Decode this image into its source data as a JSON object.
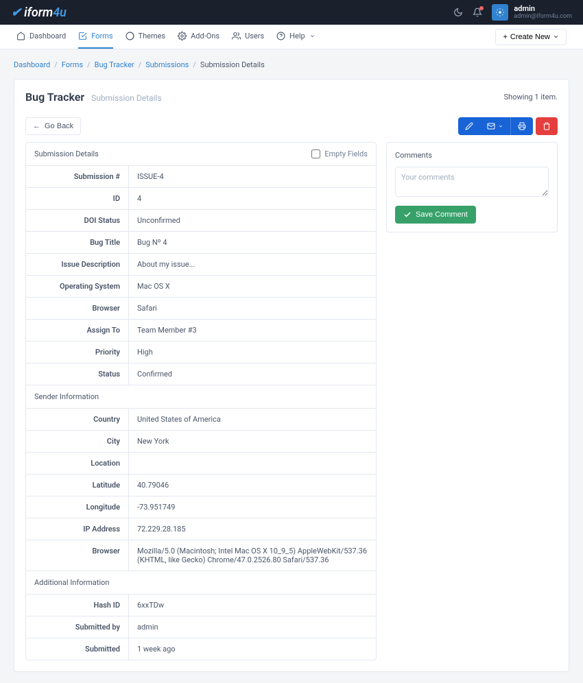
{
  "topbar": {
    "user_name": "admin",
    "user_email": "admin@iform4u.com"
  },
  "nav": {
    "dashboard": "Dashboard",
    "forms": "Forms",
    "themes": "Themes",
    "addons": "Add-Ons",
    "users": "Users",
    "help": "Help",
    "create_new": "Create New"
  },
  "breadcrumb": {
    "dashboard": "Dashboard",
    "forms": "Forms",
    "bug_tracker": "Bug Tracker",
    "submissions": "Submissions",
    "current": "Submission Details"
  },
  "page": {
    "title": "Bug Tracker",
    "subtitle": "Submission Details",
    "showing": "Showing 1 item."
  },
  "toolbar": {
    "go_back": "Go Back"
  },
  "details": {
    "panel_title": "Submission Details",
    "empty_fields_label": "Empty Fields",
    "rows": {
      "submission_num": {
        "label": "Submission #",
        "value": "ISSUE-4"
      },
      "id": {
        "label": "ID",
        "value": "4"
      },
      "doi_status": {
        "label": "DOI Status",
        "value": "Unconfirmed"
      },
      "bug_title": {
        "label": "Bug Title",
        "value": "Bug Nº 4"
      },
      "issue_description": {
        "label": "Issue Description",
        "value": "About my issue..."
      },
      "operating_system": {
        "label": "Operating System",
        "value": "Mac OS X"
      },
      "browser": {
        "label": "Browser",
        "value": "Safari"
      },
      "assign_to": {
        "label": "Assign To",
        "value": "Team Member #3"
      },
      "priority": {
        "label": "Priority",
        "value": "High"
      },
      "status": {
        "label": "Status",
        "value": "Confirmed"
      }
    },
    "sender_section": "Sender Information",
    "sender": {
      "country": {
        "label": "Country",
        "value": "United States of America"
      },
      "city": {
        "label": "City",
        "value": "New York"
      },
      "location": {
        "label": "Location",
        "value": ""
      },
      "latitude": {
        "label": "Latitude",
        "value": "40.79046"
      },
      "longitude": {
        "label": "Longitude",
        "value": "-73.951749"
      },
      "ip": {
        "label": "IP Address",
        "value": "72.229.28.185"
      },
      "browser": {
        "label": "Browser",
        "value": "Mozilla/5.0 (Macintosh; Intel Mac OS X 10_9_5) AppleWebKit/537.36 (KHTML, like Gecko) Chrome/47.0.2526.80 Safari/537.36"
      }
    },
    "additional_section": "Additional Information",
    "additional": {
      "hash_id": {
        "label": "Hash ID",
        "value": "6xxTDw"
      },
      "submitted_by": {
        "label": "Submitted by",
        "value": "admin"
      },
      "submitted": {
        "label": "Submitted",
        "value": "1 week ago"
      }
    }
  },
  "comments": {
    "title": "Comments",
    "placeholder": "Your comments",
    "save_label": "Save Comment"
  }
}
